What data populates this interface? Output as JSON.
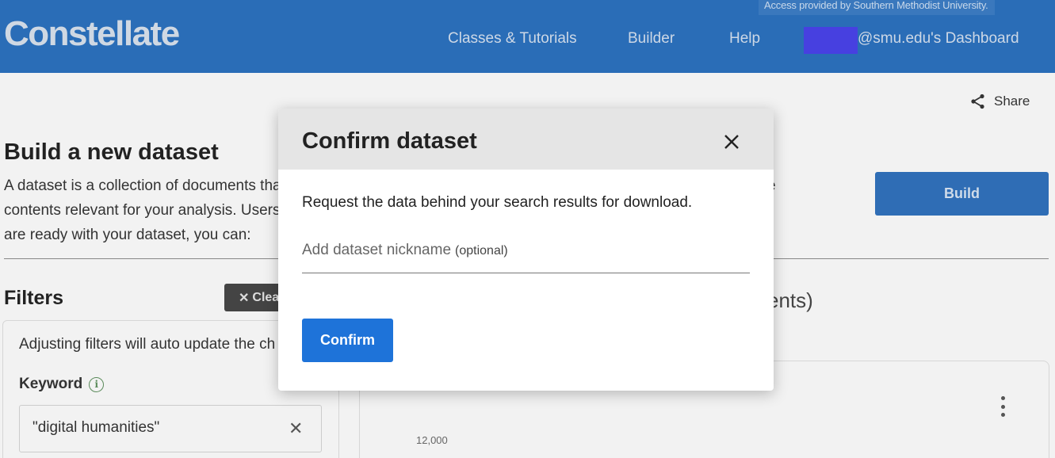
{
  "header": {
    "access_note": "Access provided by Southern Methodist University.",
    "logo": "Constellate",
    "nav": {
      "classes": "Classes & Tutorials",
      "builder": "Builder",
      "help": "Help",
      "dashboard": "@smu.edu's Dashboard"
    }
  },
  "page": {
    "share_label": "Share",
    "title": "Build a new dataset",
    "intro_lines": [
      "A dataset is a collection of documents tha",
      "contents relevant for your analysis. Users",
      "are ready with your dataset, you can:"
    ],
    "intro_trail": "e",
    "build_label": "Build",
    "filters_title": "Filters",
    "clear_label": "Clea",
    "filter_note": "Adjusting filters will auto update the ch",
    "keyword_label": "Keyword",
    "keyword_value": "\"digital humanities\"",
    "results_heading_fragment": "ents)",
    "axis_tick": "12,000"
  },
  "modal": {
    "title": "Confirm dataset",
    "description": "Request the data behind your search results for download.",
    "nickname_placeholder": "Add dataset nickname",
    "nickname_optional": "(optional)",
    "confirm_label": "Confirm"
  },
  "colors": {
    "header_bg": "#2a6db7",
    "primary_button": "#1e73d9",
    "redaction": "#4740e0"
  }
}
